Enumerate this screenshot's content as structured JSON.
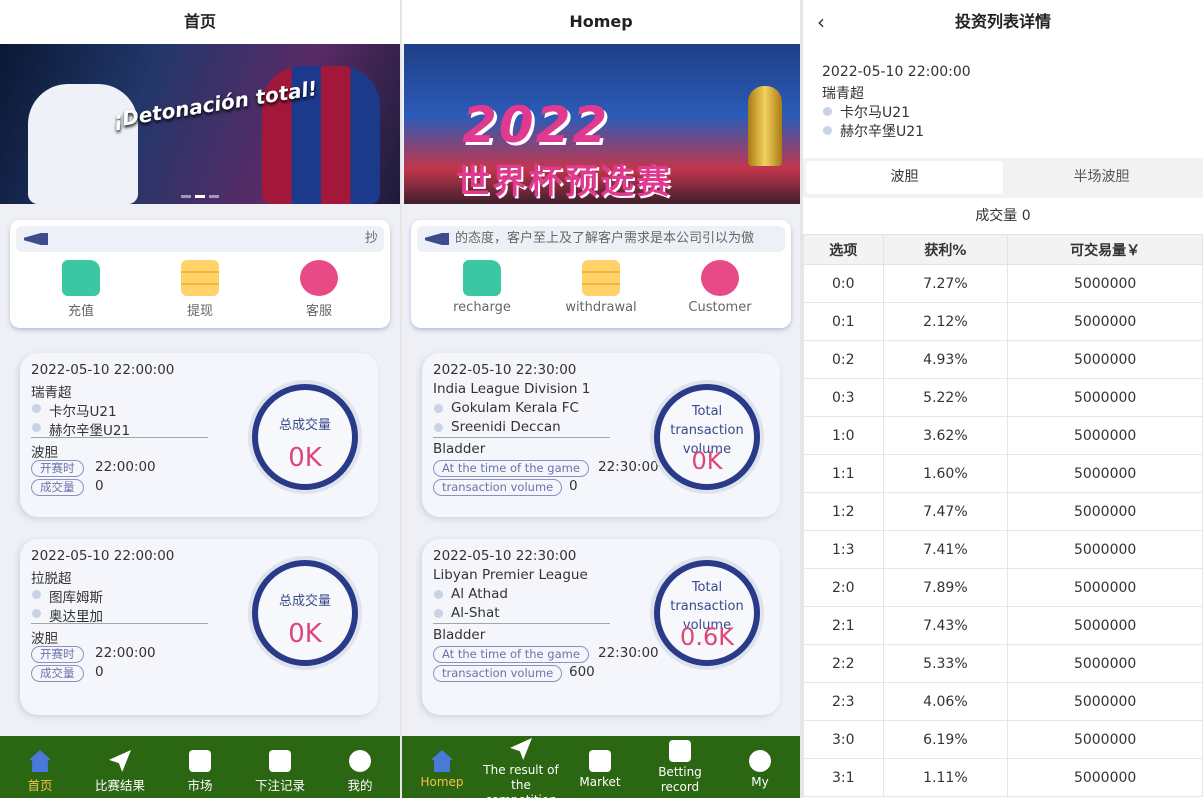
{
  "panel1": {
    "title": "首页",
    "notice_text": "抄",
    "nav": [
      {
        "label": "充值",
        "icon": "wallet-icon"
      },
      {
        "label": "提现",
        "icon": "cash-icon"
      },
      {
        "label": "客服",
        "icon": "customer-service-icon"
      }
    ],
    "matches": [
      {
        "date": "2022-05-10 22:00:00",
        "league": "瑞青超",
        "team1": "卡尔马U21",
        "team2": "赫尔辛堡U21",
        "type": "波胆",
        "kickoff_label": "开赛时",
        "kickoff": "22:00:00",
        "volume_label": "成交量",
        "volume": "0",
        "total_label": "总成交量",
        "total": "0K"
      },
      {
        "date": "2022-05-10 22:00:00",
        "league": "拉脱超",
        "team1": "图库姆斯",
        "team2": "奥达里加",
        "type": "波胆",
        "kickoff_label": "开赛时",
        "kickoff": "22:00:00",
        "volume_label": "成交量",
        "volume": "0",
        "total_label": "总成交量",
        "total": "0K"
      }
    ],
    "tabs": [
      {
        "label": "首页",
        "icon": "home-icon"
      },
      {
        "label": "比赛结果",
        "icon": "paper-plane-icon"
      },
      {
        "label": "市场",
        "icon": "market-icon"
      },
      {
        "label": "下注记录",
        "icon": "betting-record-icon"
      },
      {
        "label": "我的",
        "icon": "smiley-icon"
      }
    ]
  },
  "panel2": {
    "title": "Homep",
    "notice_text": "的态度，客户至上及了解客户需求是本公司引以为傲",
    "banner_big": "2022",
    "banner_sub": "世界杯预选赛",
    "nav": [
      {
        "label": "recharge",
        "icon": "wallet-icon"
      },
      {
        "label": "withdrawal",
        "icon": "cash-icon"
      },
      {
        "label": "Customer",
        "icon": "customer-service-icon"
      }
    ],
    "matches": [
      {
        "date": "2022-05-10 22:30:00",
        "league": "India League Division 1",
        "team1": "Gokulam Kerala FC",
        "team2": "Sreenidi Deccan",
        "type": "Bladder",
        "kickoff_label": "At the time of the game",
        "kickoff": "22:30:00",
        "volume_label": "transaction volume",
        "volume": "0",
        "total_label": "Total transaction volume",
        "total": "0K"
      },
      {
        "date": "2022-05-10 22:30:00",
        "league": "Libyan Premier League",
        "team1": "Al Athad",
        "team2": "Al-Shat",
        "type": "Bladder",
        "kickoff_label": "At the time of the game",
        "kickoff": "22:30:00",
        "volume_label": "transaction volume",
        "volume": "600",
        "total_label": "Total transaction volume",
        "total": "0.6K"
      }
    ],
    "tabs": [
      {
        "label": "Homep",
        "icon": "home-icon"
      },
      {
        "label": "The result of the competition",
        "icon": "paper-plane-icon"
      },
      {
        "label": "Market",
        "icon": "market-icon"
      },
      {
        "label": "Betting record",
        "icon": "betting-record-icon"
      },
      {
        "label": "My",
        "icon": "smiley-icon"
      }
    ]
  },
  "panel3": {
    "title": "投资列表详情",
    "date": "2022-05-10 22:00:00",
    "league": "瑞青超",
    "team1": "卡尔马U21",
    "team2": "赫尔辛堡U21",
    "seg_tabs": [
      "波胆",
      "半场波胆"
    ],
    "volume_text": "成交量 0",
    "headers": [
      "选项",
      "获利%",
      "可交易量￥"
    ],
    "rows": [
      [
        "0:0",
        "7.27%",
        "5000000"
      ],
      [
        "0:1",
        "2.12%",
        "5000000"
      ],
      [
        "0:2",
        "4.93%",
        "5000000"
      ],
      [
        "0:3",
        "5.22%",
        "5000000"
      ],
      [
        "1:0",
        "3.62%",
        "5000000"
      ],
      [
        "1:1",
        "1.60%",
        "5000000"
      ],
      [
        "1:2",
        "7.47%",
        "5000000"
      ],
      [
        "1:3",
        "7.41%",
        "5000000"
      ],
      [
        "2:0",
        "7.89%",
        "5000000"
      ],
      [
        "2:1",
        "7.43%",
        "5000000"
      ],
      [
        "2:2",
        "5.33%",
        "5000000"
      ],
      [
        "2:3",
        "4.06%",
        "5000000"
      ],
      [
        "3:0",
        "6.19%",
        "5000000"
      ],
      [
        "3:1",
        "1.11%",
        "5000000"
      ]
    ]
  },
  "colors": {
    "accent": "#283a88",
    "tabbar": "#2b6613",
    "active_tab": "#f5c24a",
    "value_pink": "#e0457a"
  }
}
